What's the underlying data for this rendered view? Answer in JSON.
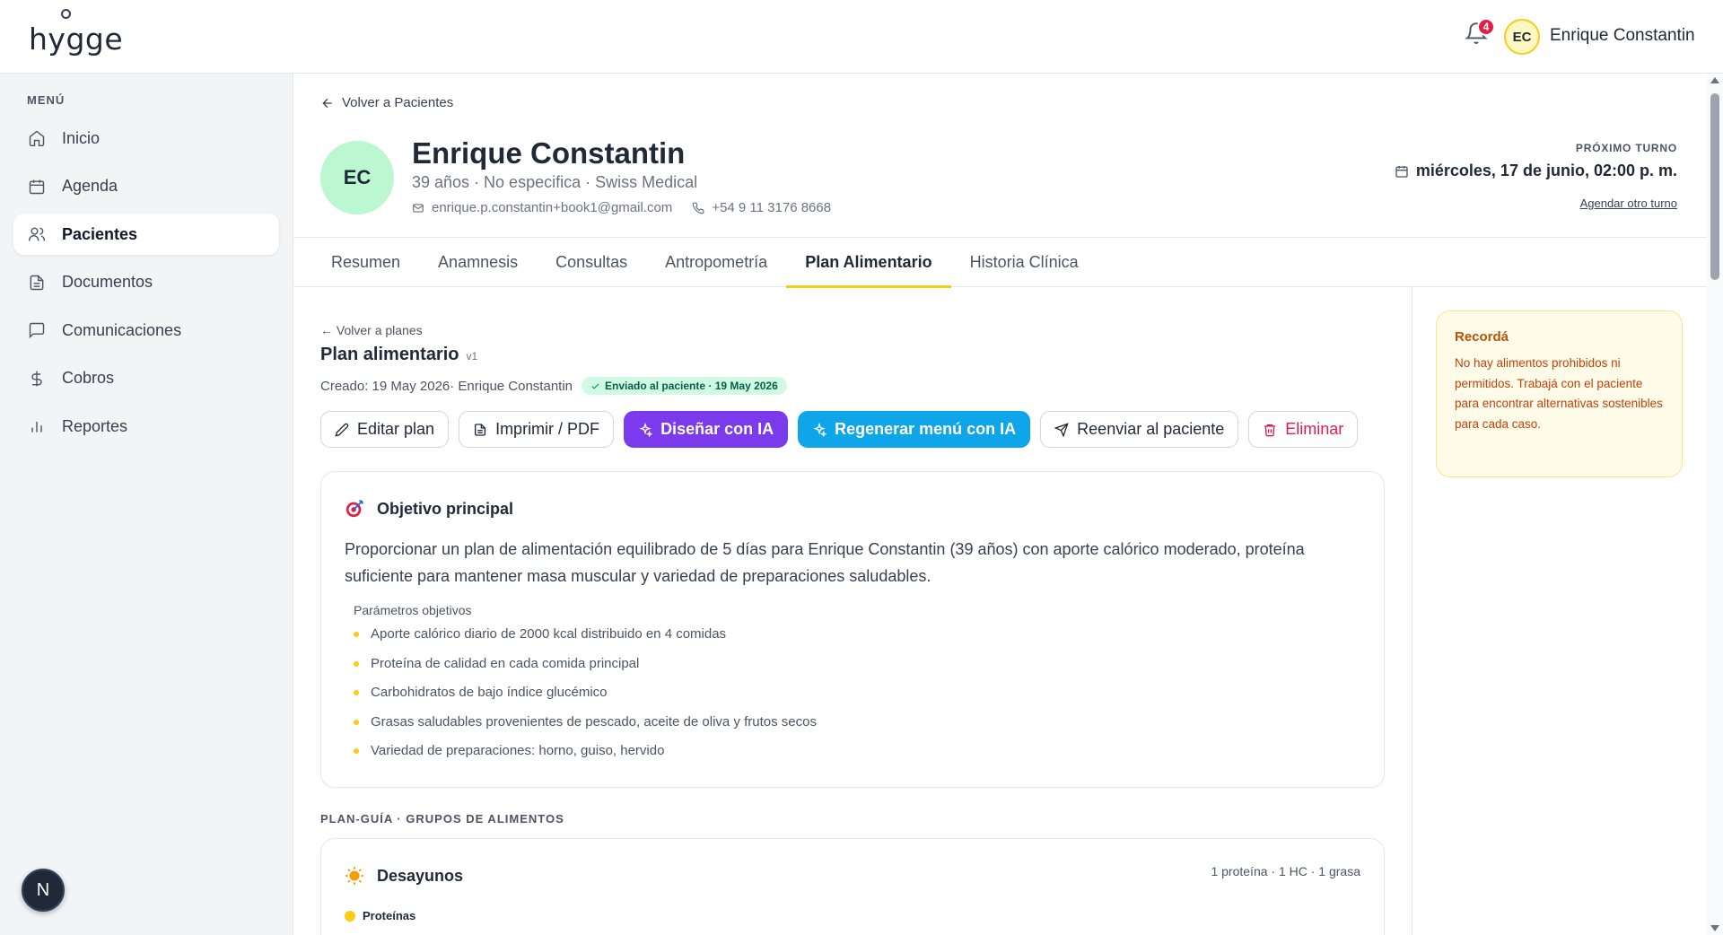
{
  "app": {
    "logo_text": "hygge"
  },
  "topbar": {
    "notification_count": "4",
    "user_initials": "EC",
    "user_name": "Enrique Constantin"
  },
  "sidebar": {
    "menu_title": "MENÚ",
    "items": [
      {
        "label": "Inicio",
        "icon": "home-icon"
      },
      {
        "label": "Agenda",
        "icon": "calendar-icon"
      },
      {
        "label": "Pacientes",
        "icon": "users-icon",
        "active": true
      },
      {
        "label": "Documentos",
        "icon": "document-icon"
      },
      {
        "label": "Comunicaciones",
        "icon": "chat-icon"
      },
      {
        "label": "Cobros",
        "icon": "dollar-icon"
      },
      {
        "label": "Reportes",
        "icon": "bar-chart-icon"
      }
    ],
    "bottom_badge": "N"
  },
  "patient": {
    "back_label": "Volver a Pacientes",
    "initials": "EC",
    "name": "Enrique Constantin",
    "meta": "39 años · No especifica · Swiss Medical",
    "email": "enrique.p.constantin+book1@gmail.com",
    "phone": "+54 9 11 3176 8668",
    "next_label": "PRÓXIMO TURNO",
    "next_date": "miércoles, 17 de junio, 02:00 p. m.",
    "next_link": "Agendar otro turno"
  },
  "tabs": [
    {
      "label": "Resumen"
    },
    {
      "label": "Anamnesis"
    },
    {
      "label": "Consultas"
    },
    {
      "label": "Antropometría"
    },
    {
      "label": "Plan Alimentario",
      "active": true
    },
    {
      "label": "Historia Clínica"
    }
  ],
  "plan": {
    "back_label": "← Volver a planes",
    "title": "Plan alimentario",
    "version": "v1",
    "created": "Creado: 19 May 2026· Enrique Constantin",
    "sent_badge": "Enviado al paciente · 19 May 2026",
    "actions": {
      "edit": "Editar plan",
      "print": "Imprimir / PDF",
      "design_ai": "Diseñar con IA",
      "regen_ai": "Regenerar menú con IA",
      "resend": "Reenviar al paciente",
      "delete": "Eliminar"
    },
    "objective": {
      "title": "Objetivo principal",
      "text": "Proporcionar un plan de alimentación equilibrado de 5 días para Enrique Constantin (39 años) con aporte calórico moderado, proteína suficiente para mantener masa muscular y variedad de preparaciones saludables.",
      "params_title": "Parámetros objetivos",
      "params": [
        "Aporte calórico diario de 2000 kcal distribuido en 4 comidas",
        "Proteína de calidad en cada comida principal",
        "Carbohidratos de bajo índice glucémico",
        "Grasas saludables provenientes de pescado, aceite de oliva y frutos secos",
        "Variedad de preparaciones: horno, guiso, hervido"
      ]
    },
    "section_label": "PLAN-GUÍA · GRUPOS DE ALIMENTOS",
    "breakfast": {
      "title": "Desayunos",
      "meta": "1 proteína · 1 HC · 1 grasa",
      "first_group": "Proteínas"
    }
  },
  "reminder": {
    "title": "Recordá",
    "text": "No hay alimentos prohibidos ni permitidos. Trabajá con el paciente para encontrar alternativas sostenibles para cada caso."
  },
  "colors": {
    "accent": "#facc15",
    "purple": "#7c3aed",
    "blue": "#0ea5e9",
    "danger": "#e11d48",
    "avatar_green": "#bbf7d0"
  }
}
